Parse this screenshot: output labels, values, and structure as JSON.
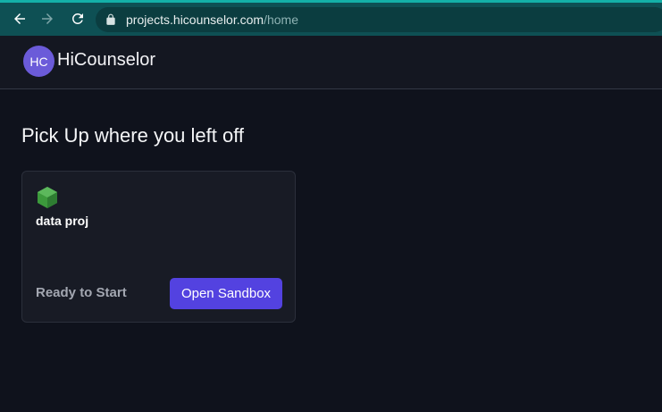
{
  "browser": {
    "url_host": "projects.hicounselor.com",
    "url_path": "/home",
    "back_icon": "arrow-left-icon",
    "forward_icon": "arrow-right-icon",
    "reload_icon": "reload-icon",
    "lock_icon": "lock-icon"
  },
  "header": {
    "avatar_initials": "HC",
    "brand": "HiCounselor"
  },
  "main": {
    "title": "Pick Up where you left off",
    "project_card": {
      "icon": "nodejs-hexagon-icon",
      "name": "data proj",
      "status": "Ready to Start",
      "button_label": "Open Sandbox"
    }
  },
  "colors": {
    "browser_bar": "#0e5054",
    "page_bg": "#0f121c",
    "accent": "#5342e0",
    "avatar": "#6b5bd9"
  }
}
